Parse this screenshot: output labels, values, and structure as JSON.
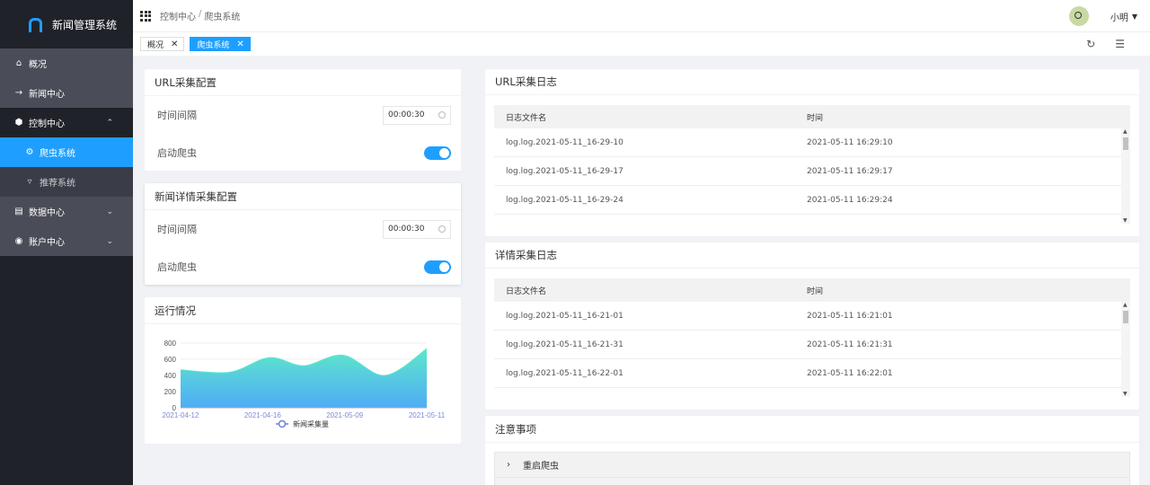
{
  "sidebar": {
    "title": "新闻管理系统",
    "items": [
      {
        "label": "概况",
        "icon": "home-icon"
      },
      {
        "label": "新闻中心",
        "icon": "arrow-right-icon"
      },
      {
        "label": "控制中心",
        "icon": "hexagon-icon"
      },
      {
        "label": "数据中心",
        "icon": "database-icon"
      },
      {
        "label": "账户中心",
        "icon": "account-icon"
      }
    ],
    "subitems": [
      {
        "label": "爬虫系统",
        "icon": "gear-icon"
      },
      {
        "label": "推荐系统",
        "icon": "funnel-icon"
      }
    ]
  },
  "header": {
    "breadcrumb": [
      "控制中心",
      "爬虫系统"
    ],
    "breadcrumb_sep": "/",
    "user": "小明"
  },
  "tabs": [
    {
      "label": "概况",
      "active": false
    },
    {
      "label": "爬虫系统",
      "active": true
    }
  ],
  "url_config": {
    "title": "URL采集配置",
    "interval_label": "时间间隔",
    "interval_value": "00:00:30",
    "start_label": "启动爬虫"
  },
  "detail_config": {
    "title": "新闻详情采集配置",
    "interval_label": "时间间隔",
    "interval_value": "00:00:30",
    "start_label": "启动爬虫"
  },
  "run_status": {
    "title": "运行情况"
  },
  "chart_data": {
    "type": "area",
    "x": [
      "2021-04-12",
      "2021-04-16",
      "2021-05-09",
      "2021-05-11"
    ],
    "x_ticks": [
      "2021-04-12",
      "2021-04-16",
      "2021-05-09",
      "2021-05-11"
    ],
    "series": [
      {
        "name": "新闻采集量",
        "x": [
          0,
          0.2,
          0.36,
          0.5,
          0.66,
          0.83,
          1.0
        ],
        "values": [
          470,
          440,
          620,
          520,
          650,
          400,
          730
        ]
      }
    ],
    "ylim": [
      0,
      800
    ],
    "yticks": [
      0,
      200,
      400,
      600,
      800
    ],
    "gradient": [
      "#4facf7",
      "#5ee7c9"
    ],
    "legend_position": "bottom"
  },
  "url_log": {
    "title": "URL采集日志",
    "columns": [
      "日志文件名",
      "时间"
    ],
    "rows": [
      [
        "log.log.2021-05-11_16-29-10",
        "2021-05-11 16:29:10"
      ],
      [
        "log.log.2021-05-11_16-29-17",
        "2021-05-11 16:29:17"
      ],
      [
        "log.log.2021-05-11_16-29-24",
        "2021-05-11 16:29:24"
      ]
    ]
  },
  "detail_log": {
    "title": "详情采集日志",
    "columns": [
      "日志文件名",
      "时间"
    ],
    "rows": [
      [
        "log.log.2021-05-11_16-21-01",
        "2021-05-11 16:21:01"
      ],
      [
        "log.log.2021-05-11_16-21-31",
        "2021-05-11 16:21:31"
      ],
      [
        "log.log.2021-05-11_16-22-01",
        "2021-05-11 16:22:01"
      ]
    ]
  },
  "notes": {
    "title": "注意事项",
    "items": [
      "重启爬虫"
    ]
  },
  "colors": {
    "accent": "#1e9fff",
    "sidebar_bg": "#20222a"
  }
}
